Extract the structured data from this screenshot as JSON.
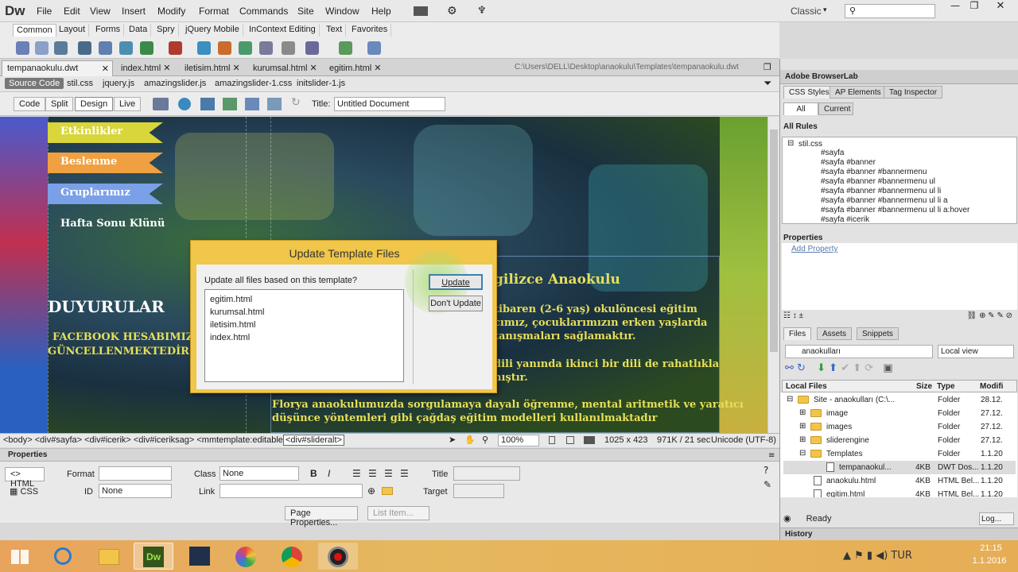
{
  "app": {
    "logo": "Dw",
    "workspace": "Classic",
    "search_placeholder": ""
  },
  "menu": [
    "File",
    "Edit",
    "View",
    "Insert",
    "Modify",
    "Format",
    "Commands",
    "Site",
    "Window",
    "Help"
  ],
  "insert_tabs": [
    "Common",
    "Layout",
    "Forms",
    "Data",
    "Spry",
    "jQuery Mobile",
    "InContext Editing",
    "Text",
    "Favorites"
  ],
  "doc_tabs": [
    "tempanaokulu.dwt",
    "index.html",
    "iletisim.html",
    "kurumsal.html",
    "egitim.html"
  ],
  "doc_path": "C:\\Users\\DELL\\Desktop\\anaokulu\\Templates\\tempanaokulu.dwt",
  "related_files": [
    "Source Code",
    "stil.css",
    "jquery.js",
    "amazingslider.js",
    "amazingslider-1.css",
    "initslider-1.js"
  ],
  "view_buttons": [
    "Code",
    "Split",
    "Design",
    "Live"
  ],
  "title_label": "Title:",
  "title_value": "Untitled Document",
  "design": {
    "menu_items": [
      "Etkinlikler",
      "Beslenme",
      "Gruplarımız",
      "Hafta Sonu Klünü"
    ],
    "duyurular": "DUYURULAR",
    "facebook_line1": "FACEBOOK HESABIMIZ",
    "facebook_line2": "GÜNCELLENMEKTEDİR.",
    "heading": "gilizce Anaokulu",
    "para1_l1": "tibaren (2-6 yaş) okulöncesi eğitim",
    "para1_l2": "cımız, çocuklarımızın erken yaşlarda",
    "para1_l3": "tanışmaları sağlamaktır.",
    "para2_l1": "dili yanında ikinci bir dili de rahatlıkla",
    "para2_l2": "nıştır.",
    "para3_l1": "Florya anaokulumuzda sorgulamaya dayalı öğrenme, mental aritmetik ve yaratıcı",
    "para3_l2": "düşünce yöntemleri gibi çağdaş eğitim modelleri kullanılmaktadır"
  },
  "dialog": {
    "title": "Update Template Files",
    "prompt": "Update all files based on this template?",
    "files": [
      "egitim.html",
      "kurumsal.html",
      "iletisim.html",
      "index.html"
    ],
    "update": "Update",
    "dont_update": "Don't Update"
  },
  "tagbar": {
    "path": "<body> <div#sayfa> <div#icerik> <div#iceriksag> <mmtemplate:editable>",
    "selected": "<div#slideralt>",
    "zoom": "100%",
    "size": "1025 x 423",
    "weight": "971K / 21 sec",
    "encoding": "Unicode (UTF-8)"
  },
  "properties": {
    "header": "Properties",
    "html_btn": "HTML",
    "css_btn": "CSS",
    "format_label": "Format",
    "format_value": "",
    "class_label": "Class",
    "class_value": "None",
    "id_label": "ID",
    "id_value": "None",
    "link_label": "Link",
    "link_value": "",
    "title_label": "Title",
    "target_label": "Target",
    "bold": "B",
    "italic": "I",
    "page_props": "Page Properties...",
    "list_item": "List Item..."
  },
  "right_panel": {
    "browserlab": "Adobe BrowserLab",
    "css_tabs": [
      "CSS Styles",
      "AP Elements",
      "Tag Inspector"
    ],
    "mode_tabs": [
      "All",
      "Current"
    ],
    "all_rules": "All Rules",
    "stylesheet": "stil.css",
    "rules": [
      "#sayfa",
      "#sayfa #banner",
      "#sayfa #banner #bannermenu",
      "#sayfa #banner #bannermenu ul",
      "#sayfa #banner #bannermenu ul li",
      "#sayfa #banner #bannermenu ul li a",
      "#sayfa #banner #bannermenu ul li a:hover",
      "#sayfa #icerik"
    ],
    "properties": "Properties",
    "add_property": "Add Property",
    "files_tabs": [
      "Files",
      "Assets",
      "Snippets"
    ],
    "site": "anaokulları",
    "view": "Local view",
    "col_local": "Local Files",
    "col_size": "Size",
    "col_type": "Type",
    "col_mod": "Modifi",
    "files": [
      {
        "name": "Site - anaokulları (C:\\...",
        "size": "",
        "type": "Folder",
        "mod": "28.12.",
        "level": 0,
        "kind": "folder"
      },
      {
        "name": "image",
        "size": "",
        "type": "Folder",
        "mod": "27.12.",
        "level": 1,
        "kind": "folder"
      },
      {
        "name": "images",
        "size": "",
        "type": "Folder",
        "mod": "27.12.",
        "level": 1,
        "kind": "folder"
      },
      {
        "name": "sliderengine",
        "size": "",
        "type": "Folder",
        "mod": "27.12.",
        "level": 1,
        "kind": "folder"
      },
      {
        "name": "Templates",
        "size": "",
        "type": "Folder",
        "mod": "1.1.20",
        "level": 1,
        "kind": "folder"
      },
      {
        "name": "tempanaokul...",
        "size": "4KB",
        "type": "DWT Dos...",
        "mod": "1.1.20",
        "level": 2,
        "kind": "file"
      },
      {
        "name": "anaokulu.html",
        "size": "4KB",
        "type": "HTML Bel...",
        "mod": "1.1.20",
        "level": 1,
        "kind": "file"
      },
      {
        "name": "egitim.html",
        "size": "4KB",
        "type": "HTML Bel...",
        "mod": "1.1.20",
        "level": 1,
        "kind": "file"
      }
    ],
    "status": "Ready",
    "log": "Log...",
    "history": "History"
  },
  "taskbar": {
    "time": "21:15",
    "date": "1.1.2016"
  },
  "colors": {
    "ribbon1": "#d8d63a",
    "ribbon2": "#f0a040",
    "ribbon3": "#7aa0e8",
    "dialog": "#f0c64b",
    "accent_text": "#e6df5a"
  }
}
